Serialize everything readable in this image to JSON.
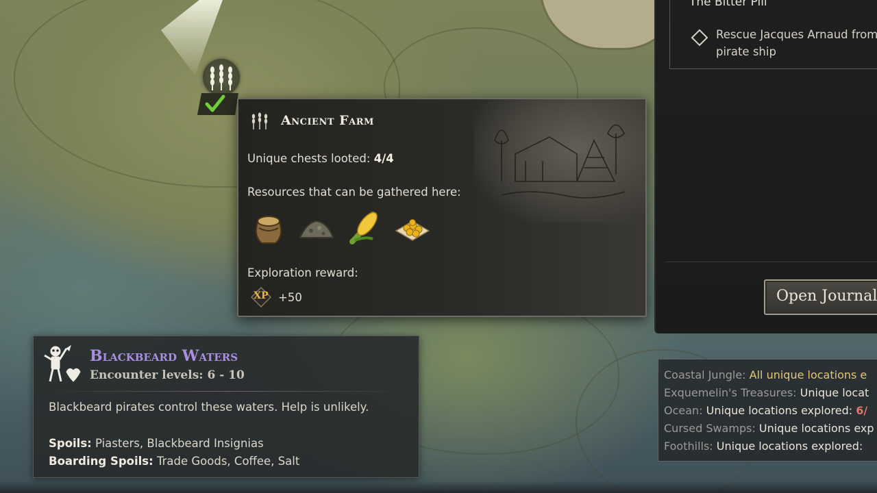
{
  "tooltip": {
    "title": "Ancient Farm",
    "chests_label": "Unique chests looted:",
    "chests_value": "4/4",
    "resources_label": "Resources that can be gathered here:",
    "resources": [
      "grain-sack-icon",
      "ore-pile-icon",
      "corn-icon",
      "fruit-crate-icon"
    ],
    "reward_label": "Exploration reward:",
    "xp_badge": "XP",
    "xp_value": "+50"
  },
  "region": {
    "name": "Blackbeard Waters",
    "levels": "Encounter levels: 6 - 10",
    "description": "Blackbeard pirates control these waters. Help is unlikely.",
    "spoils_label": "Spoils:",
    "spoils_value": "Piasters, Blackbeard Insignias",
    "boarding_label": "Boarding Spoils:",
    "boarding_value": "Trade Goods, Coffee, Salt"
  },
  "journal": {
    "quest_title": "The Bitter Pill",
    "quest_desc_line1": "Rescue Jacques Arnaud from ca",
    "quest_desc_line2": "pirate ship",
    "open_button": "Open Journal"
  },
  "summary": {
    "rows": [
      {
        "label": "Coastal Jungle:",
        "text": "All unique locations e",
        "style": "gold"
      },
      {
        "label": "Exquemelin's Treasures:",
        "text": "Unique locat",
        "style": "plain"
      },
      {
        "label": "Ocean:",
        "text": "Unique locations explored:",
        "highlight": "6/",
        "style": "plain"
      },
      {
        "label": "Cursed Swamps:",
        "text": "Unique locations exp",
        "style": "plain"
      },
      {
        "label": "Foothills:",
        "text": "Unique locations explored:",
        "style": "plain"
      }
    ]
  },
  "colors": {
    "region_name": "#a98fe0",
    "map_land": "#7e8458",
    "map_water": "#51666a",
    "check_green": "#6fcf3a"
  }
}
